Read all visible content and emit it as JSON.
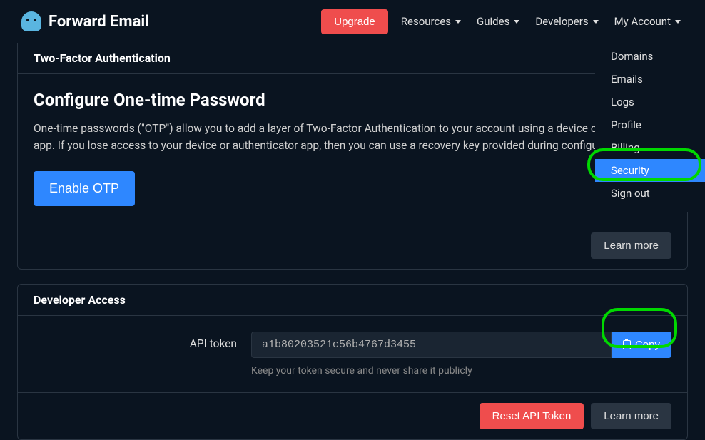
{
  "brand": "Forward Email",
  "nav": {
    "upgrade": "Upgrade",
    "resources": "Resources",
    "guides": "Guides",
    "developers": "Developers",
    "account": "My Account"
  },
  "dropdown": {
    "domains": "Domains",
    "emails": "Emails",
    "logs": "Logs",
    "profile": "Profile",
    "billing": "Billing",
    "security": "Security",
    "signout": "Sign out"
  },
  "twofa": {
    "header": "Two-Factor Authentication",
    "title": "Configure One-time Password",
    "description": "One-time passwords (\"OTP\") allow you to add a layer of Two-Factor Authentication to your account using a device or authenticator app. If you lose access to your device or authenticator app, then you can use a recovery key provided during configuration.",
    "enable": "Enable OTP",
    "learn_more": "Learn more"
  },
  "developer": {
    "header": "Developer Access",
    "label": "API token",
    "token": "a1b80203521c56b4767d3455",
    "copy": "Copy",
    "help": "Keep your token secure and never share it publicly",
    "reset": "Reset API Token",
    "learn_more": "Learn more"
  }
}
